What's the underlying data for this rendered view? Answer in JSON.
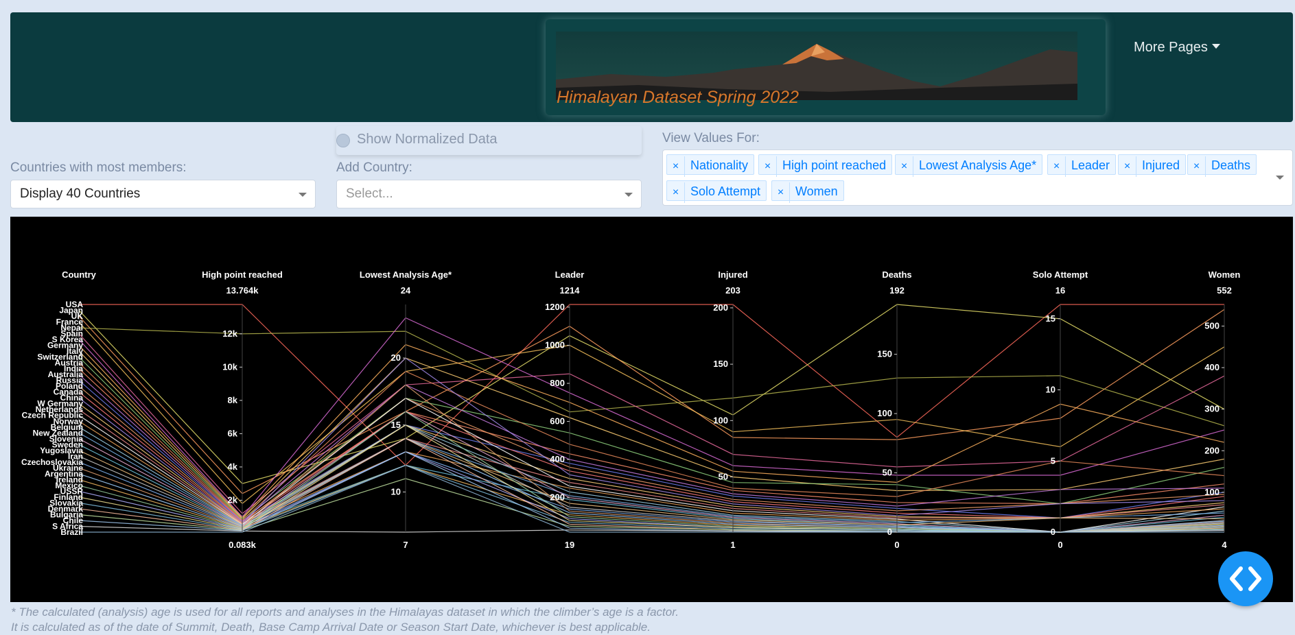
{
  "header": {
    "banner_title": "Himalayan Dataset Spring 2022",
    "more_pages_label": "More Pages"
  },
  "controls": {
    "countries_label": "Countries with most members:",
    "countries_value": "Display 40 Countries",
    "normalize_label": "Show Normalized Data",
    "add_country_label": "Add Country:",
    "add_country_placeholder": "Select...",
    "view_values_label": "View Values For:",
    "view_values_tags": [
      "Nationality",
      "High point reached",
      "Lowest Analysis Age*",
      "Leader",
      "Injured",
      "Deaths",
      "Solo Attempt",
      "Women"
    ]
  },
  "footnote": {
    "line1": "* The calculated (analysis) age is used for all reports and analyses in the Himalayas dataset in which the climber’s age is a factor.",
    "line2": "It is calculated as of the date of Summit, Death, Base Camp Arrival Date or Season Start Date, whichever is best applicable."
  },
  "colors": {
    "header_bg": "#0b3b3f",
    "title_orange": "#d9782b",
    "plot_bg": "#000000",
    "tag_blue": "#007eff",
    "code_button": "#1a95f5"
  },
  "icons": {
    "code_button": "chevron-left-right-icon",
    "radio": "radio-icon",
    "dropdown": "chevron-down-icon"
  },
  "chart_data": {
    "type": "parallel_coordinates",
    "categories": [
      "USA",
      "Japan",
      "UK",
      "France",
      "Nepal",
      "Spain",
      "S Korea",
      "Germany",
      "Italy",
      "Switzerland",
      "Austria",
      "India",
      "Australia",
      "Russia",
      "Poland",
      "Canada",
      "China",
      "W Germany",
      "Netherlands",
      "Czech Republic",
      "Norway",
      "Belgium",
      "New Zealand",
      "Slovenia",
      "Sweden",
      "Yugoslavia",
      "Iran",
      "Czechoslovakia",
      "Ukraine",
      "Argentina",
      "Ireland",
      "Mexico",
      "USSR",
      "Finland",
      "Slovakia",
      "Denmark",
      "Bulgaria",
      "Chile",
      "S Africa",
      "Brazil"
    ],
    "dimensions": [
      {
        "label": "Country",
        "range_labels": [
          "",
          ""
        ]
      },
      {
        "label": "High point reached",
        "range": [
          83,
          13764
        ],
        "max_label": "13.764k",
        "min_label": "0.083k",
        "ticks": [
          {
            "v": 2000,
            "t": "2k"
          },
          {
            "v": 4000,
            "t": "4k"
          },
          {
            "v": 6000,
            "t": "6k"
          },
          {
            "v": 8000,
            "t": "8k"
          },
          {
            "v": 10000,
            "t": "10k"
          },
          {
            "v": 12000,
            "t": "12k"
          }
        ]
      },
      {
        "label": "Lowest Analysis Age*",
        "range": [
          7,
          24
        ],
        "max_label": "24",
        "min_label": "7",
        "ticks": [
          {
            "v": 10,
            "t": "10"
          },
          {
            "v": 15,
            "t": "15"
          },
          {
            "v": 20,
            "t": "20"
          }
        ]
      },
      {
        "label": "Leader",
        "range": [
          19,
          1214
        ],
        "max_label": "1214",
        "min_label": "19",
        "ticks": [
          {
            "v": 200,
            "t": "200"
          },
          {
            "v": 400,
            "t": "400"
          },
          {
            "v": 600,
            "t": "600"
          },
          {
            "v": 800,
            "t": "800"
          },
          {
            "v": 1000,
            "t": "1000"
          },
          {
            "v": 1200,
            "t": "1200"
          }
        ]
      },
      {
        "label": "Injured",
        "range": [
          1,
          203
        ],
        "max_label": "203",
        "min_label": "1",
        "ticks": [
          {
            "v": 50,
            "t": "50"
          },
          {
            "v": 100,
            "t": "100"
          },
          {
            "v": 150,
            "t": "150"
          },
          {
            "v": 200,
            "t": "200"
          }
        ]
      },
      {
        "label": "Deaths",
        "range": [
          0,
          192
        ],
        "max_label": "192",
        "min_label": "0",
        "ticks": [
          {
            "v": 0,
            "t": "0"
          },
          {
            "v": 50,
            "t": "50"
          },
          {
            "v": 100,
            "t": "100"
          },
          {
            "v": 150,
            "t": "150"
          }
        ]
      },
      {
        "label": "Solo Attempt",
        "range": [
          0,
          16
        ],
        "max_label": "16",
        "min_label": "0",
        "ticks": [
          {
            "v": 0,
            "t": "0"
          },
          {
            "v": 5,
            "t": "5"
          },
          {
            "v": 10,
            "t": "10"
          },
          {
            "v": 15,
            "t": "15"
          }
        ]
      },
      {
        "label": "Women",
        "range": [
          4,
          552
        ],
        "max_label": "552",
        "min_label": "4",
        "ticks": [
          {
            "v": 100,
            "t": "100"
          },
          {
            "v": 200,
            "t": "200"
          },
          {
            "v": 300,
            "t": "300"
          },
          {
            "v": 400,
            "t": "400"
          },
          {
            "v": 500,
            "t": "500"
          }
        ]
      }
    ],
    "rows": [
      [
        13764,
        12,
        1214,
        203,
        80,
        16,
        552
      ],
      [
        3000,
        14,
        1050,
        105,
        192,
        15,
        300
      ],
      [
        2400,
        16,
        1100,
        85,
        78,
        8,
        540
      ],
      [
        1800,
        19,
        1000,
        90,
        95,
        6,
        450
      ],
      [
        12000,
        22,
        650,
        120,
        130,
        11,
        260
      ],
      [
        1200,
        18,
        850,
        70,
        55,
        5,
        380
      ],
      [
        1000,
        23,
        750,
        60,
        48,
        4,
        250
      ],
      [
        950,
        21,
        700,
        55,
        42,
        9,
        220
      ],
      [
        900,
        20,
        620,
        50,
        35,
        3,
        180
      ],
      [
        850,
        17,
        540,
        45,
        40,
        2,
        160
      ],
      [
        800,
        19,
        480,
        40,
        30,
        5,
        140
      ],
      [
        760,
        16,
        430,
        38,
        25,
        2,
        120
      ],
      [
        720,
        18,
        400,
        35,
        22,
        3,
        110
      ],
      [
        690,
        15,
        380,
        33,
        20,
        1,
        100
      ],
      [
        660,
        17,
        360,
        30,
        18,
        2,
        95
      ],
      [
        630,
        16,
        340,
        28,
        16,
        1,
        90
      ],
      [
        600,
        20,
        320,
        26,
        14,
        2,
        80
      ],
      [
        580,
        15,
        300,
        24,
        13,
        1,
        75
      ],
      [
        560,
        14,
        280,
        22,
        12,
        1,
        70
      ],
      [
        540,
        17,
        260,
        20,
        11,
        0,
        65
      ],
      [
        520,
        13,
        250,
        18,
        10,
        1,
        60
      ],
      [
        500,
        15,
        230,
        16,
        9,
        0,
        55
      ],
      [
        480,
        14,
        210,
        15,
        8,
        1,
        50
      ],
      [
        460,
        16,
        200,
        14,
        7,
        0,
        45
      ],
      [
        440,
        12,
        190,
        13,
        6,
        0,
        40
      ],
      [
        420,
        14,
        170,
        12,
        6,
        1,
        36
      ],
      [
        400,
        15,
        150,
        11,
        5,
        0,
        32
      ],
      [
        380,
        13,
        140,
        10,
        5,
        0,
        30
      ],
      [
        360,
        18,
        130,
        9,
        4,
        0,
        28
      ],
      [
        340,
        14,
        120,
        8,
        4,
        0,
        26
      ],
      [
        320,
        12,
        110,
        7,
        3,
        0,
        24
      ],
      [
        300,
        16,
        100,
        6,
        3,
        0,
        22
      ],
      [
        280,
        13,
        90,
        5,
        2,
        0,
        20
      ],
      [
        260,
        15,
        80,
        5,
        2,
        0,
        18
      ],
      [
        240,
        12,
        70,
        4,
        2,
        0,
        16
      ],
      [
        220,
        14,
        60,
        3,
        1,
        0,
        14
      ],
      [
        200,
        11,
        50,
        3,
        1,
        0,
        12
      ],
      [
        180,
        13,
        40,
        2,
        1,
        0,
        10
      ],
      [
        150,
        7,
        30,
        2,
        0,
        0,
        8
      ],
      [
        83,
        12,
        19,
        1,
        0,
        0,
        4
      ]
    ],
    "line_colors": [
      "#ff6a5c",
      "#e8e16a",
      "#ff9e5e",
      "#f7c25c",
      "#b9b94f",
      "#e86a9c",
      "#d96bd6",
      "#ffb15e",
      "#ffcf73",
      "#8fd17e",
      "#e88a5a",
      "#ff8f6b",
      "#c77be0",
      "#6f7ef0",
      "#f0a06a",
      "#ff7a7a",
      "#a088e8",
      "#ffd27a",
      "#f08a8a",
      "#ffffff",
      "#f2a85c",
      "#9ed1e8",
      "#79b0e8",
      "#e8a8d0",
      "#6cc0d8",
      "#f0c080",
      "#d0d0d0",
      "#7fb0f0",
      "#e0a070",
      "#a0d0ff",
      "#f4b860",
      "#9ad0a0",
      "#b0b0ff",
      "#f0e090",
      "#80c0e0",
      "#ffc0a0",
      "#c0e0a0",
      "#a0c8f0",
      "#e0e0e0",
      "#90b8d8"
    ]
  }
}
